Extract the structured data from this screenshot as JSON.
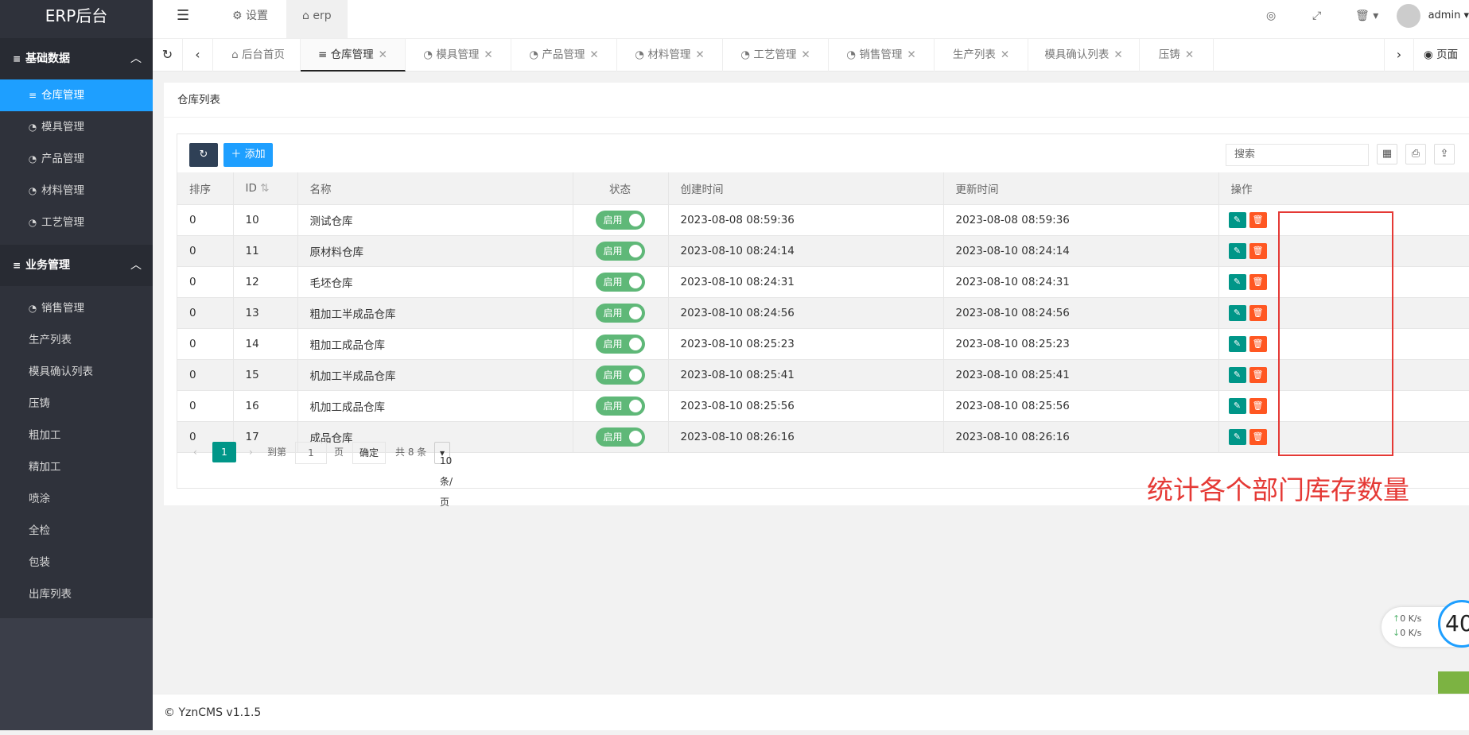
{
  "app": {
    "title": "ERP后台"
  },
  "sidebar": {
    "groups": [
      {
        "label": "基础数据",
        "items": [
          "仓库管理",
          "模具管理",
          "产品管理",
          "材料管理",
          "工艺管理"
        ]
      },
      {
        "label": "业务管理",
        "items": [
          "销售管理",
          "生产列表",
          "模具确认列表",
          "压铸",
          "粗加工",
          "精加工",
          "喷涂",
          "全检",
          "包装",
          "出库列表"
        ]
      }
    ]
  },
  "header": {
    "settings_label": "设置",
    "erp_label": "erp",
    "user": "admin"
  },
  "tabs": {
    "items": [
      "后台首页",
      "仓库管理",
      "模具管理",
      "产品管理",
      "材料管理",
      "工艺管理",
      "销售管理",
      "生产列表",
      "模具确认列表",
      "压铸"
    ],
    "page_label": "页面"
  },
  "panel": {
    "title": "仓库列表"
  },
  "toolbar": {
    "add_label": "添加",
    "search_placeholder": "搜索"
  },
  "table": {
    "headers": [
      "排序",
      "ID",
      "名称",
      "状态",
      "创建时间",
      "更新时间",
      "操作"
    ],
    "rows": [
      [
        "0",
        "10",
        "测试仓库",
        "启用",
        "2023-08-08 08:59:36",
        "2023-08-08 08:59:36"
      ],
      [
        "0",
        "11",
        "原材料仓库",
        "启用",
        "2023-08-10 08:24:14",
        "2023-08-10 08:24:14"
      ],
      [
        "0",
        "12",
        "毛坯仓库",
        "启用",
        "2023-08-10 08:24:31",
        "2023-08-10 08:24:31"
      ],
      [
        "0",
        "13",
        "粗加工半成品仓库",
        "启用",
        "2023-08-10 08:24:56",
        "2023-08-10 08:24:56"
      ],
      [
        "0",
        "14",
        "粗加工成品仓库",
        "启用",
        "2023-08-10 08:25:23",
        "2023-08-10 08:25:23"
      ],
      [
        "0",
        "15",
        "机加工半成品仓库",
        "启用",
        "2023-08-10 08:25:41",
        "2023-08-10 08:25:41"
      ],
      [
        "0",
        "16",
        "机加工成品仓库",
        "启用",
        "2023-08-10 08:25:56",
        "2023-08-10 08:25:56"
      ],
      [
        "0",
        "17",
        "成品仓库",
        "启用",
        "2023-08-10 08:26:16",
        "2023-08-10 08:26:16"
      ]
    ]
  },
  "pager": {
    "current": "1",
    "goto_label": "到第",
    "page_input": "1",
    "page_unit": "页",
    "confirm": "确定",
    "total": "共 8 条",
    "per_page": "10 条/页"
  },
  "annotation": {
    "text": "统计各个部门库存数量"
  },
  "footer": {
    "text": "© YznCMS v1.1.5"
  },
  "net_widget": {
    "up": "0",
    "down": "0",
    "unit": "K/s",
    "gauge": "40"
  },
  "colors": {
    "sidebar": "#3b3e49",
    "active": "#1e9fff",
    "switch": "#5fb878",
    "edit": "#009688",
    "delete": "#ff5722",
    "annotation": "#e53935"
  }
}
